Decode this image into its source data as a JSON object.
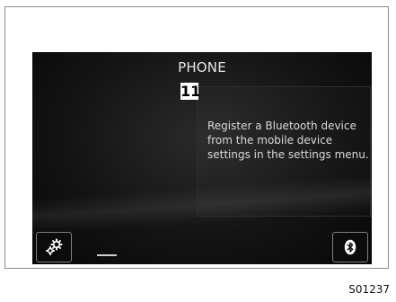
{
  "screen": {
    "title": "PHONE",
    "callout_number": "11",
    "message": "Register a Bluetooth device from the mobile device settings in the settings menu."
  },
  "buttons": {
    "settings_icon": "gears-icon",
    "bluetooth_icon": "bluetooth-icon"
  },
  "figure_code": "S01237",
  "colors": {
    "screen_bg": "#141414",
    "text": "#e8e8e8",
    "button_border": "#7e7e7e"
  }
}
